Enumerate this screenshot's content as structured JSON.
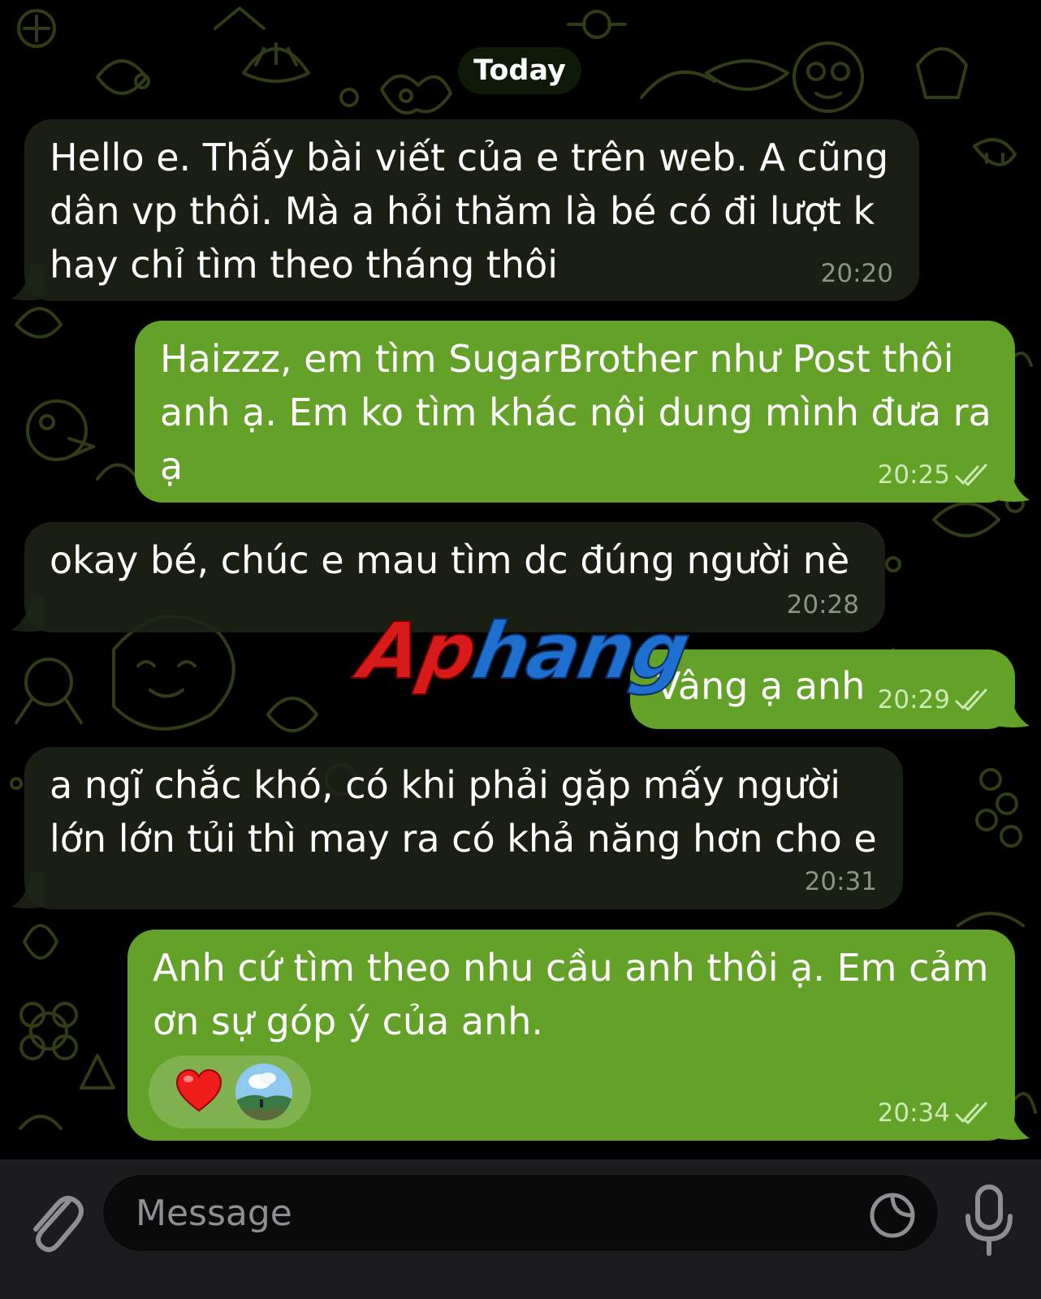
{
  "chat": {
    "date_separator": "Today",
    "messages": [
      {
        "direction": "incoming",
        "lines": [
          "Hello e. Thấy bài viết của e trên web. A cũng",
          "dân vp thôi. Mà a hỏi thăm là bé có đi lượt k",
          "hay chỉ tìm theo tháng thôi"
        ],
        "time": "20:20"
      },
      {
        "direction": "outgoing",
        "lines": [
          "Haizzz, em tìm SugarBrother như Post thôi",
          "anh ạ. Em ko tìm khác nội dung mình đưa ra",
          "ạ"
        ],
        "time": "20:25",
        "read": true
      },
      {
        "direction": "incoming",
        "lines": [
          "okay bé, chúc e mau tìm dc đúng người nè"
        ],
        "time": "20:28"
      },
      {
        "direction": "outgoing",
        "lines": [
          "Vâng ạ anh"
        ],
        "time": "20:29",
        "read": true
      },
      {
        "direction": "incoming",
        "lines": [
          "a ngĩ chắc khó, có khi phải gặp mấy người",
          "lớn lớn tủi thì may ra có khả năng hơn cho e"
        ],
        "time": "20:31"
      },
      {
        "direction": "outgoing",
        "lines": [
          "Anh cứ tìm theo nhu cầu anh thôi ạ. Em cảm",
          "ơn sự góp ý của anh."
        ],
        "time": "20:34",
        "read": true,
        "reactions": [
          "heart-emoji",
          "reactor-avatar"
        ]
      }
    ]
  },
  "watermark": {
    "part1": "Ap",
    "part2": "hang"
  },
  "composer": {
    "placeholder": "Message",
    "value": "",
    "icons": [
      "paperclip-icon",
      "sticker-icon",
      "microphone-icon"
    ]
  },
  "colors": {
    "background": "#000000",
    "incoming_bubble": "#1c2416",
    "outgoing_bubble": "#63a128",
    "doodle": "#2e3a14",
    "input_bar": "#1c1c1e"
  }
}
